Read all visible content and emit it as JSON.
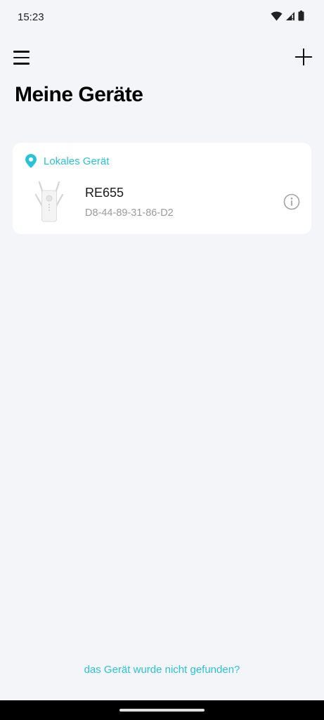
{
  "status_bar": {
    "time": "15:23",
    "icons": [
      "wifi-icon",
      "cellular-signal-icon",
      "battery-icon"
    ]
  },
  "header": {
    "title": "Meine Geräte",
    "menu_icon": "hamburger-menu-icon",
    "add_icon": "plus-icon"
  },
  "device_list": {
    "section_label": "Lokales Gerät",
    "section_icon": "location-pin-icon",
    "devices": [
      {
        "name": "RE655",
        "mac": "D8-44-89-31-86-D2",
        "info_icon": "info-icon"
      }
    ]
  },
  "footer": {
    "not_found_link": "das Gerät wurde nicht gefunden?"
  },
  "colors": {
    "accent": "#29c3d8",
    "background": "#f4f5f9",
    "card": "#ffffff",
    "secondary_text": "#9a9a9a"
  }
}
